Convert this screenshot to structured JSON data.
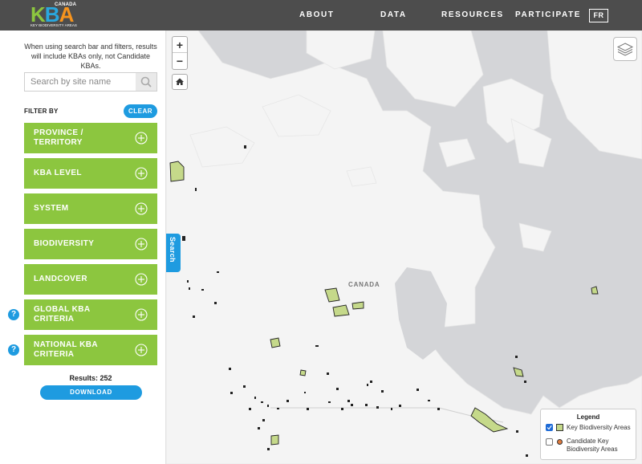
{
  "header": {
    "logo": {
      "country": "CANADA",
      "letters": [
        "K",
        "B",
        "A"
      ],
      "tagline": "KEY BIODIVERSITY AREAS"
    },
    "nav": [
      "ABOUT",
      "DATA",
      "RESOURCES",
      "PARTICIPATE"
    ],
    "lang": "FR"
  },
  "sidebar": {
    "notice": "When using search bar and filters, results will include KBAs only, not Candidate KBAs.",
    "search_placeholder": "Search by site name",
    "filter_by": "FILTER BY",
    "clear": "CLEAR",
    "filters": [
      {
        "label": "PROVINCE / TERRITORY",
        "help": false
      },
      {
        "label": "KBA LEVEL",
        "help": false
      },
      {
        "label": "SYSTEM",
        "help": false
      },
      {
        "label": "BIODIVERSITY",
        "help": false
      },
      {
        "label": "LANDCOVER",
        "help": false
      },
      {
        "label": "GLOBAL KBA CRITERIA",
        "help": true
      },
      {
        "label": "NATIONAL KBA CRITERIA",
        "help": true
      }
    ],
    "help_glyph": "?",
    "results": "Results: 252",
    "download": "DOWNLOAD"
  },
  "map": {
    "zoom_in": "+",
    "zoom_out": "−",
    "search_tab": "Search",
    "country_label": "CANADA",
    "legend": {
      "title": "Legend",
      "items": [
        {
          "label": "Key Biodiversity Areas",
          "checked": true
        },
        {
          "label": "Candidate Key Biodiversity Areas",
          "checked": false
        }
      ]
    }
  },
  "colors": {
    "accent_green": "#8cc63f",
    "accent_blue": "#1e9be0",
    "header_bg": "#4d4d4d",
    "water": "#d4d5d8",
    "land": "#f4f4f4",
    "kba_fill": "#c5d98a",
    "candidate": "#e07a3c"
  }
}
